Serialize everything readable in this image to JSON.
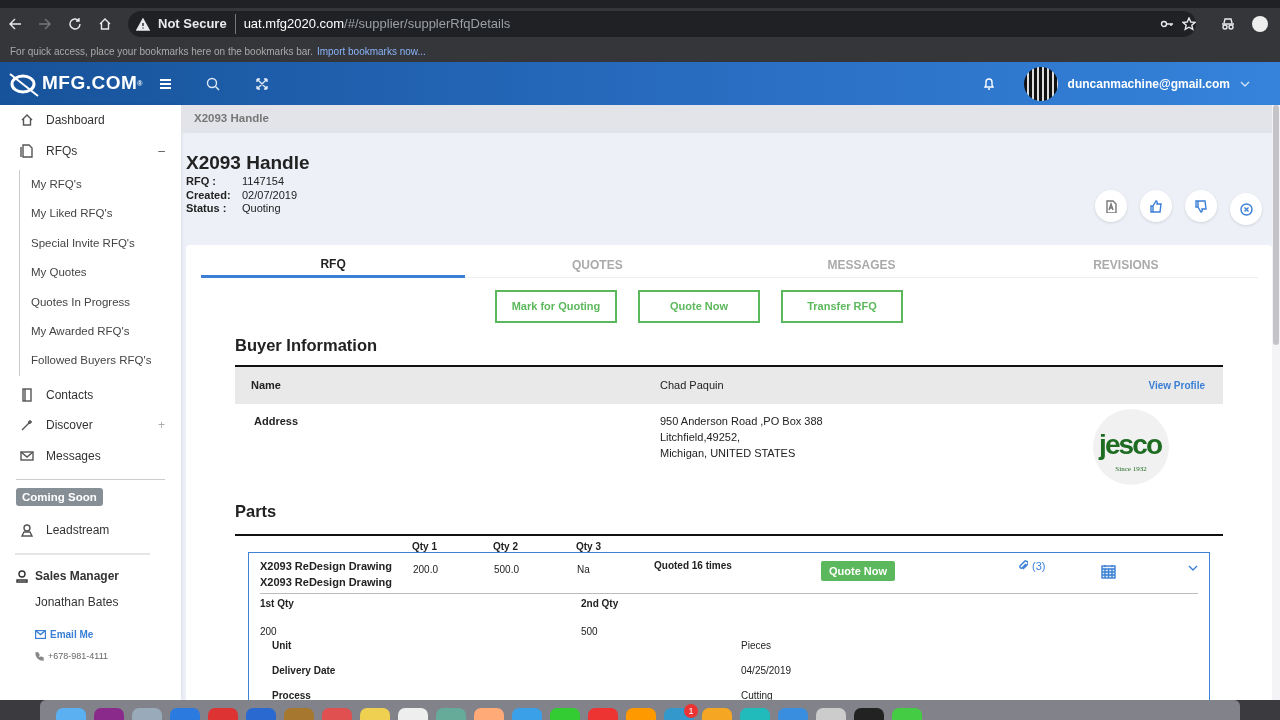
{
  "browser": {
    "security": "Not Secure",
    "url_host": "uat.mfg2020.com",
    "url_path": "/#/supplier/supplerRfqDetails",
    "bookmarks_hint": "For quick access, place your bookmarks here on the bookmarks bar.",
    "bookmarks_link": "Import bookmarks now..."
  },
  "header": {
    "logo": "MFG.COM",
    "logo_mark": "®",
    "user": "duncanmachine@gmail.com"
  },
  "sidebar": {
    "items": [
      {
        "label": "Dashboard"
      },
      {
        "label": "RFQs",
        "toggle": "–",
        "expanded": true,
        "children": [
          {
            "label": "My RFQ's"
          },
          {
            "label": "My Liked RFQ's"
          },
          {
            "label": "Special Invite RFQ's"
          },
          {
            "label": "My Quotes"
          },
          {
            "label": "Quotes In Progress"
          },
          {
            "label": "My Awarded RFQ's"
          },
          {
            "label": "Followed Buyers RFQ's"
          }
        ]
      },
      {
        "label": "Contacts"
      },
      {
        "label": "Discover",
        "toggle": "+",
        "expanded": false
      },
      {
        "label": "Messages"
      }
    ],
    "badge": "Coming Soon",
    "leadstream": "Leadstream",
    "manager": {
      "title": "Sales Manager",
      "name": "Jonathan Bates",
      "email": "Email Me",
      "phone": "+678-981-4111"
    }
  },
  "breadcrumb": "X2093 Handle",
  "title": "X2093 Handle",
  "meta": [
    {
      "label": "RFQ :",
      "value": "1147154"
    },
    {
      "label": "Created:",
      "value": "02/07/2019"
    },
    {
      "label": "Status :",
      "value": "Quoting"
    }
  ],
  "tabs": [
    {
      "label": "RFQ",
      "selected": true
    },
    {
      "label": "QUOTES",
      "selected": false
    },
    {
      "label": "MESSAGES",
      "selected": false
    },
    {
      "label": "REVISIONS",
      "selected": false
    }
  ],
  "buttons": [
    "Mark for Quoting",
    "Quote Now",
    "Transfer RFQ"
  ],
  "buyer": {
    "heading": "Buyer Information",
    "name_label": "Name",
    "name": "Chad Paquin",
    "link": "View Profile",
    "address_label": "Address",
    "address": [
      "950 Anderson Road ,PO Box 388",
      "Litchfield,49252,",
      "Michigan, UNITED STATES"
    ],
    "logo_text": "jesco",
    "logo_sub": "Since 1932"
  },
  "parts": {
    "heading": "Parts",
    "columns": [
      "Qty 1",
      "Qty 2",
      "Qty 3"
    ],
    "part": {
      "names": [
        "X2093 ReDesign Drawing",
        "X2093 ReDesign Drawing"
      ],
      "qtys": [
        "200.0",
        "500.0",
        "Na"
      ],
      "quoted": "Quoted 16 times",
      "action": "Quote Now",
      "attachments": "(3)",
      "expanded": true,
      "qty_labels": [
        "1st Qty",
        "2nd Qty"
      ],
      "qty_values": [
        "200",
        "500"
      ],
      "details": [
        {
          "label": "Unit",
          "value": "Pieces"
        },
        {
          "label": "Delivery Date",
          "value": "04/25/2019"
        },
        {
          "label": "Process",
          "value": "Cutting"
        }
      ]
    }
  },
  "dock": {
    "badge": "1"
  }
}
